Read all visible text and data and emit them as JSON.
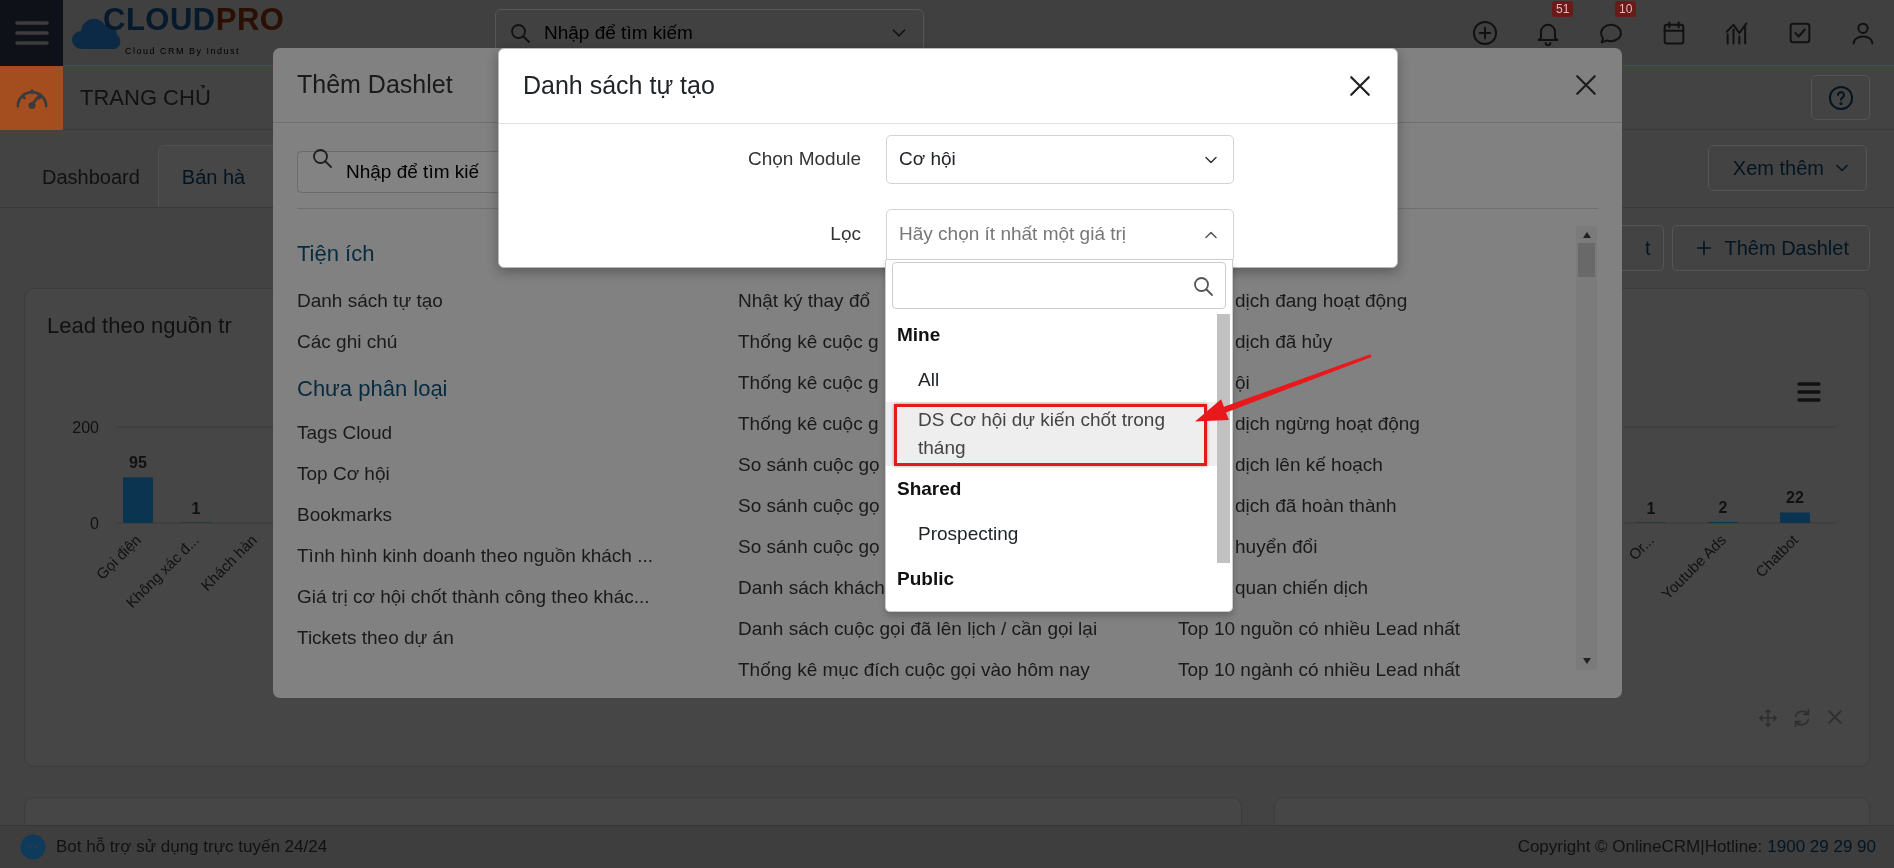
{
  "topbar": {
    "logo": {
      "main": "CLOUD",
      "accent": "PRO",
      "tagline": "Cloud CRM By Indust"
    },
    "search": {
      "placeholder": "Nhập để tìm kiếm"
    },
    "notification_badge": "51",
    "message_badge": "10"
  },
  "page_header": {
    "title": "TRANG CHỦ"
  },
  "tabs": [
    {
      "label": "Dashboard",
      "selected": false
    },
    {
      "label": "Bán hà",
      "selected": true
    }
  ],
  "more_button": "Xem thêm",
  "toolbar_buttons": [
    {
      "label": "t",
      "kind": "plain"
    },
    {
      "label": "Thêm Dashlet",
      "kind": "add"
    }
  ],
  "dashlet": {
    "title": "Lead theo nguồn tr",
    "chart_parts": [
      {
        "chart_data": {
          "type": "bar",
          "categories": [
            "Gọi điện",
            "Không xác đ...",
            "Khách hàn"
          ],
          "values": [
            95,
            1,
            null
          ],
          "ylim": [
            0,
            200
          ],
          "yticks": [
            0,
            200
          ],
          "data_labels": true
        }
      },
      {
        "chart_data": {
          "type": "bar",
          "categories": [
            "Or...",
            "Youtube Ads",
            "Chatbot"
          ],
          "values": [
            1,
            2,
            22
          ],
          "data_labels": true
        }
      }
    ]
  },
  "footer": {
    "bot_text": "Bot hỗ trợ sử dụng trực tuyến 24/24",
    "copyright": "Copyright © OnlineCRM|Hotline:",
    "hotline": "1900 29 29 90"
  },
  "add_dashlet_dialog": {
    "title": "Thêm Dashlet",
    "search": {
      "placeholder": "Nhập để tìm kiế"
    },
    "columns": [
      {
        "sections": [
          {
            "heading": "Tiện ích",
            "items": [
              {
                "label": "Danh sách tự tạo"
              },
              {
                "label": "Các ghi chú"
              }
            ]
          },
          {
            "heading": "Chưa phân loại",
            "items": [
              {
                "label": "Tags Cloud"
              },
              {
                "label": "Top Cơ hội"
              },
              {
                "label": "Bookmarks"
              },
              {
                "label": "Tình hình kinh doanh theo nguồn khách ..."
              },
              {
                "label": "Giá trị cơ hội chốt thành công theo khác..."
              },
              {
                "label": "Tickets theo dự án"
              }
            ]
          }
        ]
      },
      {
        "sections": [
          {
            "items": [
              {
                "label": "Nhật ký thay đổ"
              },
              {
                "label": "Thống kê cuộc g"
              },
              {
                "label": "Thống kê cuộc g"
              },
              {
                "label": "Thống kê cuộc g"
              },
              {
                "label": "So sánh cuộc gọ"
              },
              {
                "label": "So sánh cuộc gọ"
              },
              {
                "label": "So sánh cuộc gọ"
              },
              {
                "label": "Danh sách khách"
              },
              {
                "label": "Danh sách cuộc gọi đã lên lịch / cần gọi lại"
              },
              {
                "label": "Thống kê mục đích cuộc gọi vào hôm nay"
              }
            ]
          }
        ]
      },
      {
        "sections": [
          {
            "items": [
              {
                "label": "dịch đang hoạt động"
              },
              {
                "label": "dịch đã hủy"
              },
              {
                "label": "ội"
              },
              {
                "label": "dịch ngừng hoạt động"
              },
              {
                "label": "dịch lên kế hoạch"
              },
              {
                "label": "dịch đã hoàn thành"
              },
              {
                "label": "huyển đổi"
              },
              {
                "label": "quan chiến dịch"
              },
              {
                "label": "Top 10 nguồn có nhiều Lead nhất"
              },
              {
                "label": "Top 10 ngành có nhiều Lead nhất"
              }
            ]
          }
        ]
      }
    ]
  },
  "custom_list_dialog": {
    "title": "Danh sách tự tạo",
    "fields": [
      {
        "label": "Chọn Module",
        "kind": "select",
        "value": "Cơ hội"
      },
      {
        "label": "Lọc",
        "kind": "multiselect",
        "placeholder": "Hãy chọn ít nhất một giá trị",
        "expanded": true
      }
    ],
    "dropdown": {
      "groups": [
        {
          "name": "Mine",
          "options": [
            {
              "label": "All",
              "selected": false
            },
            {
              "label": "DS Cơ hội dự kiến chốt trong tháng",
              "selected": true
            }
          ]
        },
        {
          "name": "Shared",
          "options": [
            {
              "label": "Prospecting",
              "selected": false
            }
          ]
        },
        {
          "name": "Public"
        }
      ]
    }
  }
}
